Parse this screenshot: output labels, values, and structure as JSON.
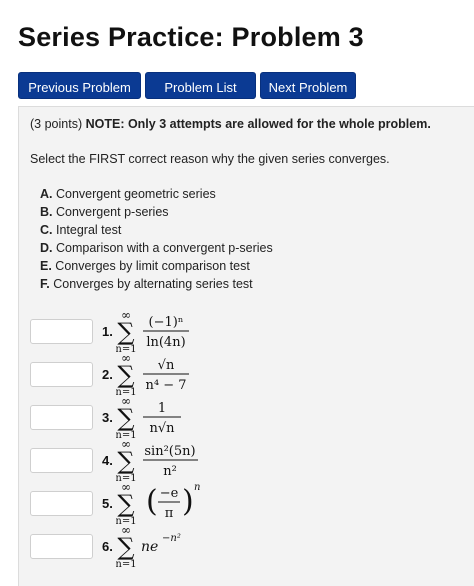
{
  "page": {
    "title": "Series Practice: Problem 3"
  },
  "nav": {
    "previous": "Previous Problem",
    "list": "Problem List",
    "next": "Next Problem"
  },
  "problem": {
    "points": "(3 points)",
    "note": "NOTE: Only 3 attempts are allowed for the whole problem.",
    "instruction": "Select the FIRST correct reason why the given series converges.",
    "options": [
      {
        "letter": "A.",
        "text": "Convergent geometric series"
      },
      {
        "letter": "B.",
        "text": "Convergent p-series"
      },
      {
        "letter": "C.",
        "text": "Integral test"
      },
      {
        "letter": "D.",
        "text": "Comparison with a convergent p-series"
      },
      {
        "letter": "E.",
        "text": "Converges by limit comparison test"
      },
      {
        "letter": "F.",
        "text": "Converges by alternating series test"
      }
    ],
    "questions": [
      {
        "number": "1.",
        "answer": "",
        "sum_upper": "∞",
        "sum_lower": "n=1",
        "numerator": "(−1)ⁿ",
        "denominator": "ln(4n)"
      },
      {
        "number": "2.",
        "answer": "",
        "sum_upper": "∞",
        "sum_lower": "n=1",
        "numerator": "√n",
        "denominator": "n⁴ − 7"
      },
      {
        "number": "3.",
        "answer": "",
        "sum_upper": "∞",
        "sum_lower": "n=1",
        "numerator": "1",
        "denominator": "n√n"
      },
      {
        "number": "4.",
        "answer": "",
        "sum_upper": "∞",
        "sum_lower": "n=1",
        "numerator": "sin²(5n)",
        "denominator": "n²"
      },
      {
        "number": "5.",
        "answer": "",
        "sum_upper": "∞",
        "sum_lower": "n=1",
        "numerator": "−e",
        "denominator": "π",
        "exponent": "n"
      },
      {
        "number": "6.",
        "answer": "",
        "sum_upper": "∞",
        "sum_lower": "n=1",
        "term": "ne",
        "exponent": "−n²"
      }
    ]
  }
}
